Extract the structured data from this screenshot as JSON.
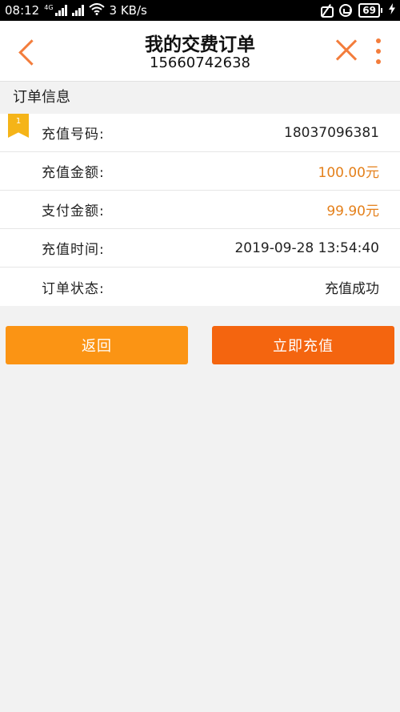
{
  "status_bar": {
    "time": "08:12",
    "network_tag": "4G",
    "speed": "3 KB/s",
    "battery": "69"
  },
  "header": {
    "title": "我的交费订单",
    "subtitle": "15660742638"
  },
  "section": {
    "title": "订单信息",
    "badge": "1"
  },
  "order": [
    {
      "label": "充值号码:",
      "value": "18037096381"
    },
    {
      "label": "充值金额:",
      "value": "100.00元"
    },
    {
      "label": "支付金额:",
      "value": "99.90元"
    },
    {
      "label": "充值时间:",
      "value": "2019-09-28 13:54:40"
    },
    {
      "label": "订单状态:",
      "value": "充值成功"
    }
  ],
  "buttons": {
    "back": "返回",
    "recharge": "立即充值"
  },
  "colors": {
    "accent": "#f37d3c",
    "amount": "#e4801b",
    "back_button": "#fb9414",
    "recharge_button": "#f4650f",
    "badge": "#f5b418"
  }
}
